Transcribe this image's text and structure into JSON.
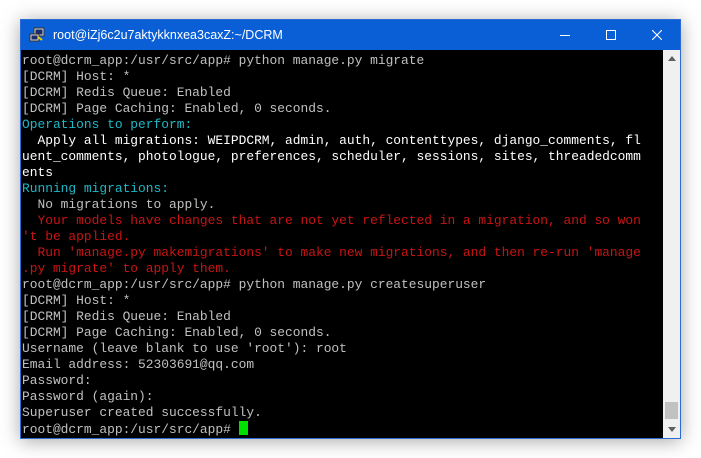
{
  "window": {
    "title": "root@iZj6c2u7aktykknxea3caxZ:~/DCRM",
    "icons": {
      "app": "putty-icon",
      "minimize": "minimize-icon",
      "maximize": "maximize-icon",
      "close": "close-icon"
    }
  },
  "terminal": {
    "colors": {
      "background": "#000000",
      "default": "#c0c0c0",
      "bright": "#ffffff",
      "cyan": "#1fb8c6",
      "yellow": "#d7c50a",
      "red": "#c81414",
      "cursor": "#00e000"
    },
    "lines": [
      {
        "text": "root@dcrm_app:/usr/src/app# python manage.py migrate",
        "color": "default"
      },
      {
        "text": "[DCRM] Host: *",
        "color": "default"
      },
      {
        "text": "[DCRM] Redis Queue: Enabled",
        "color": "default"
      },
      {
        "text": "[DCRM] Page Caching: Enabled, 0 seconds.",
        "color": "default"
      },
      {
        "text": "Operations to perform:",
        "color": "cyan"
      },
      {
        "text": "  Apply all migrations: WEIPDCRM, admin, auth, contenttypes, django_comments, fl",
        "color": "bright"
      },
      {
        "text": "uent_comments, photologue, preferences, scheduler, sessions, sites, threadedcomm",
        "color": "bright"
      },
      {
        "text": "ents",
        "color": "bright"
      },
      {
        "text": "Running migrations:",
        "color": "cyan"
      },
      {
        "text": "  No migrations to apply.",
        "color": "default"
      },
      {
        "text": "  Your models have changes that are not yet reflected in a migration, and so won",
        "color": "red"
      },
      {
        "text": "'t be applied.",
        "color": "red"
      },
      {
        "text": "  Run 'manage.py makemigrations' to make new migrations, and then re-run 'manage",
        "color": "red"
      },
      {
        "text": ".py migrate' to apply them.",
        "color": "red"
      },
      {
        "text": "root@dcrm_app:/usr/src/app# python manage.py createsuperuser",
        "color": "default"
      },
      {
        "text": "[DCRM] Host: *",
        "color": "default"
      },
      {
        "text": "[DCRM] Redis Queue: Enabled",
        "color": "default"
      },
      {
        "text": "[DCRM] Page Caching: Enabled, 0 seconds.",
        "color": "default"
      },
      {
        "text": "Username (leave blank to use 'root'): root",
        "color": "default"
      },
      {
        "text": "Email address: 52303691@qq.com",
        "color": "default"
      },
      {
        "text": "Password:",
        "color": "default"
      },
      {
        "text": "Password (again):",
        "color": "default"
      },
      {
        "text": "Superuser created successfully.",
        "color": "default"
      }
    ],
    "prompt": "root@dcrm_app:/usr/src/app# "
  },
  "scrollbar": {
    "up_icon": "scroll-up-arrow-icon",
    "down_icon": "scroll-down-arrow-icon",
    "position": 1.0
  }
}
